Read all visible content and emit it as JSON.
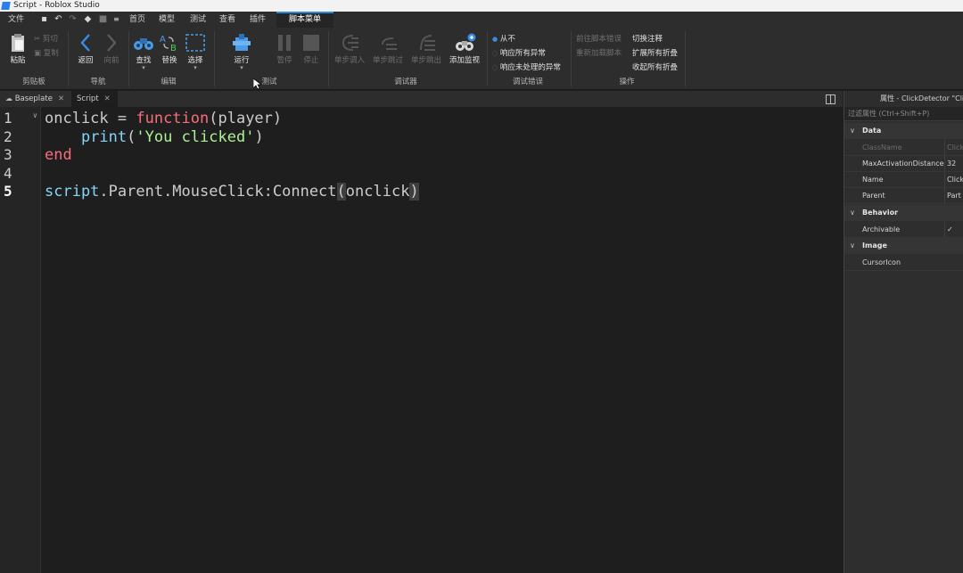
{
  "window": {
    "title": "Script - Roblox Studio"
  },
  "menubar": {
    "file": "文件",
    "tabs": [
      "首页",
      "模型",
      "测试",
      "查看",
      "插件"
    ],
    "active_tab": "脚本菜单"
  },
  "ribbon": {
    "clipboard": {
      "paste": "粘贴",
      "cut": "剪切",
      "copy": "复制",
      "group": "剪贴板"
    },
    "navigate": {
      "back": "返回",
      "forward": "向前",
      "group": "导航"
    },
    "edit": {
      "find": "查找",
      "replace": "替换",
      "select": "选择",
      "group": "编辑"
    },
    "test": {
      "run": "运行",
      "pause": "暂停",
      "stop": "停止",
      "group": "测试"
    },
    "debugger": {
      "step_into": "单步调入",
      "step_over": "单步跳过",
      "step_out": "单步跳出",
      "add_watch": "添加监视",
      "group": "调试器"
    },
    "debug_errors": {
      "never": "从不",
      "all": "响应所有异常",
      "unhandled": "响应未处理的异常",
      "group": "调试错误"
    },
    "actions": {
      "goto_error": "前往脚本错误",
      "reload": "重新加载脚本",
      "toggle_comment": "切换注释",
      "expand_all": "扩展所有折叠",
      "collapse_all": "收起所有折叠",
      "group": "操作"
    }
  },
  "doc_tabs": {
    "tab1": "Baseplate",
    "tab2": "Script"
  },
  "editor": {
    "line_numbers": [
      "1",
      "2",
      "3",
      "4",
      "5"
    ],
    "line1": {
      "a": "onclick = ",
      "b": "function",
      "c": "(player)"
    },
    "line2": {
      "indent": "    ",
      "a": "print",
      "b": "(",
      "c": "'You clicked'",
      "d": ")"
    },
    "line3": {
      "a": "end"
    },
    "line5": {
      "a": "script",
      "b": ".Parent.MouseClick:Connect",
      "c": "(",
      "d": "onclick",
      "e": ")"
    }
  },
  "properties": {
    "title": "属性 - ClickDetector \"Click",
    "filter_placeholder": "过滤属性 (Ctrl+Shift+P)",
    "categories": {
      "data": "Data",
      "behavior": "Behavior",
      "image": "Image"
    },
    "rows": {
      "classname": {
        "name": "ClassName",
        "value": "ClickD"
      },
      "maxdist": {
        "name": "MaxActivationDistance",
        "value": "32"
      },
      "name": {
        "name": "Name",
        "value": "ClickD"
      },
      "parent": {
        "name": "Parent",
        "value": "Part"
      },
      "archivable": {
        "name": "Archivable",
        "value": "✓"
      },
      "cursoricon": {
        "name": "CursorIcon",
        "value": ""
      }
    }
  }
}
